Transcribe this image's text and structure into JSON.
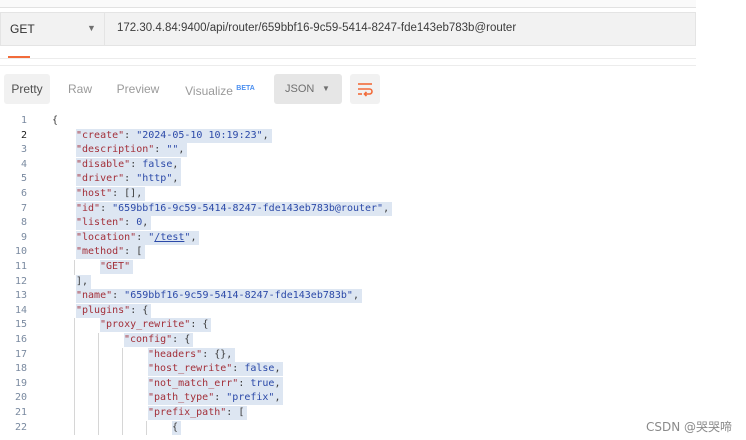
{
  "request": {
    "method": "GET",
    "url": "172.30.4.84:9400/api/router/659bbf16-9c59-5414-8247-fde143eb783b@router"
  },
  "response_toolbar": {
    "tabs": [
      {
        "label": "Pretty",
        "active": true
      },
      {
        "label": "Raw",
        "active": false
      },
      {
        "label": "Preview",
        "active": false
      },
      {
        "label": "Visualize",
        "badge": "BETA",
        "active": false
      }
    ],
    "format": "JSON",
    "wrap_icon": "wrap-lines-icon"
  },
  "code_lines": [
    {
      "n": "1",
      "indent": 0,
      "parts": [
        {
          "t": "p",
          "v": "{"
        }
      ]
    },
    {
      "n": "2",
      "indent": 1,
      "parts": [
        {
          "t": "k",
          "v": "\"create\""
        },
        {
          "t": "p",
          "v": ": "
        },
        {
          "t": "s",
          "v": "\"2024-05-10 10:19:23\""
        },
        {
          "t": "p",
          "v": ","
        }
      ]
    },
    {
      "n": "3",
      "indent": 1,
      "parts": [
        {
          "t": "k",
          "v": "\"description\""
        },
        {
          "t": "p",
          "v": ": "
        },
        {
          "t": "s",
          "v": "\"\""
        },
        {
          "t": "p",
          "v": ","
        }
      ]
    },
    {
      "n": "4",
      "indent": 1,
      "parts": [
        {
          "t": "k",
          "v": "\"disable\""
        },
        {
          "t": "p",
          "v": ": "
        },
        {
          "t": "kw",
          "v": "false"
        },
        {
          "t": "p",
          "v": ","
        }
      ]
    },
    {
      "n": "5",
      "indent": 1,
      "parts": [
        {
          "t": "k",
          "v": "\"driver\""
        },
        {
          "t": "p",
          "v": ": "
        },
        {
          "t": "s",
          "v": "\"http\""
        },
        {
          "t": "p",
          "v": ","
        }
      ]
    },
    {
      "n": "6",
      "indent": 1,
      "parts": [
        {
          "t": "k",
          "v": "\"host\""
        },
        {
          "t": "p",
          "v": ": [],"
        }
      ]
    },
    {
      "n": "7",
      "indent": 1,
      "parts": [
        {
          "t": "k",
          "v": "\"id\""
        },
        {
          "t": "p",
          "v": ": "
        },
        {
          "t": "s",
          "v": "\"659bbf16-9c59-5414-8247-fde143eb783b@router\""
        },
        {
          "t": "p",
          "v": ","
        }
      ]
    },
    {
      "n": "8",
      "indent": 1,
      "parts": [
        {
          "t": "k",
          "v": "\"listen\""
        },
        {
          "t": "p",
          "v": ": "
        },
        {
          "t": "kw",
          "v": "0"
        },
        {
          "t": "p",
          "v": ","
        }
      ]
    },
    {
      "n": "9",
      "indent": 1,
      "parts": [
        {
          "t": "k",
          "v": "\"location\""
        },
        {
          "t": "p",
          "v": ": "
        },
        {
          "t": "s",
          "v": "\""
        },
        {
          "t": "su",
          "v": "/test"
        },
        {
          "t": "s",
          "v": "\""
        },
        {
          "t": "p",
          "v": ","
        }
      ]
    },
    {
      "n": "10",
      "indent": 1,
      "parts": [
        {
          "t": "k",
          "v": "\"method\""
        },
        {
          "t": "p",
          "v": ": ["
        }
      ]
    },
    {
      "n": "11",
      "indent": 2,
      "parts": [
        {
          "t": "k",
          "v": "\"GET\""
        }
      ]
    },
    {
      "n": "12",
      "indent": 1,
      "parts": [
        {
          "t": "p",
          "v": "],"
        }
      ]
    },
    {
      "n": "13",
      "indent": 1,
      "parts": [
        {
          "t": "k",
          "v": "\"name\""
        },
        {
          "t": "p",
          "v": ": "
        },
        {
          "t": "s",
          "v": "\"659bbf16-9c59-5414-8247-fde143eb783b\""
        },
        {
          "t": "p",
          "v": ","
        }
      ]
    },
    {
      "n": "14",
      "indent": 1,
      "parts": [
        {
          "t": "k",
          "v": "\"plugins\""
        },
        {
          "t": "p",
          "v": ": {"
        }
      ]
    },
    {
      "n": "15",
      "indent": 2,
      "parts": [
        {
          "t": "k",
          "v": "\"proxy_rewrite\""
        },
        {
          "t": "p",
          "v": ": {"
        }
      ]
    },
    {
      "n": "16",
      "indent": 3,
      "parts": [
        {
          "t": "k",
          "v": "\"config\""
        },
        {
          "t": "p",
          "v": ": {"
        }
      ]
    },
    {
      "n": "17",
      "indent": 4,
      "parts": [
        {
          "t": "k",
          "v": "\"headers\""
        },
        {
          "t": "p",
          "v": ": {},"
        }
      ]
    },
    {
      "n": "18",
      "indent": 4,
      "parts": [
        {
          "t": "k",
          "v": "\"host_rewrite\""
        },
        {
          "t": "p",
          "v": ": "
        },
        {
          "t": "kw",
          "v": "false"
        },
        {
          "t": "p",
          "v": ","
        }
      ]
    },
    {
      "n": "19",
      "indent": 4,
      "parts": [
        {
          "t": "k",
          "v": "\"not_match_err\""
        },
        {
          "t": "p",
          "v": ": "
        },
        {
          "t": "kw",
          "v": "true"
        },
        {
          "t": "p",
          "v": ","
        }
      ]
    },
    {
      "n": "20",
      "indent": 4,
      "parts": [
        {
          "t": "k",
          "v": "\"path_type\""
        },
        {
          "t": "p",
          "v": ": "
        },
        {
          "t": "s",
          "v": "\"prefix\""
        },
        {
          "t": "p",
          "v": ","
        }
      ]
    },
    {
      "n": "21",
      "indent": 4,
      "parts": [
        {
          "t": "k",
          "v": "\"prefix_path\""
        },
        {
          "t": "p",
          "v": ": ["
        }
      ]
    },
    {
      "n": "22",
      "indent": 5,
      "parts": [
        {
          "t": "p",
          "v": "{"
        }
      ]
    }
  ],
  "watermark": "CSDN @哭哭啼"
}
